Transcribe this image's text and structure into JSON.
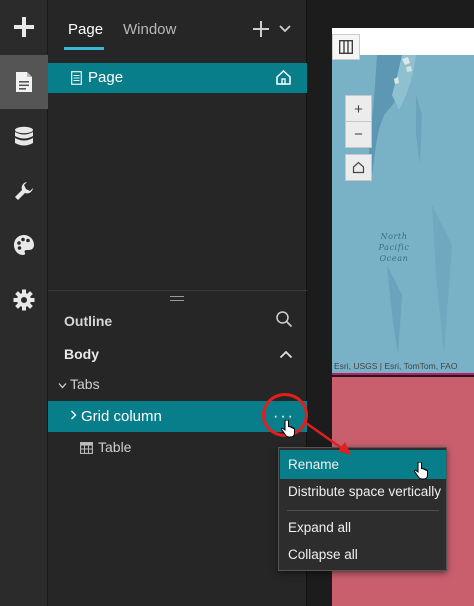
{
  "toolbar": {
    "items": [
      {
        "icon": "plus-icon"
      },
      {
        "icon": "page-icon",
        "active": true
      },
      {
        "icon": "database-icon"
      },
      {
        "icon": "wrench-icon"
      },
      {
        "icon": "palette-icon"
      },
      {
        "icon": "gear-icon"
      }
    ]
  },
  "panel": {
    "tabs": [
      {
        "label": "Page",
        "active": true
      },
      {
        "label": "Window",
        "active": false
      }
    ],
    "page_item": {
      "label": "Page"
    },
    "outline": {
      "title": "Outline",
      "body_label": "Body",
      "tabs_label": "Tabs",
      "grid_column_label": "Grid column",
      "table_label": "Table",
      "more_button": "···"
    }
  },
  "canvas": {
    "attribution": "Esri, USGS | Esri, TomTom, FAO",
    "ocean_label": "North Pacific Ocean",
    "zoom_in": "+",
    "zoom_out": "−"
  },
  "context_menu": {
    "items": [
      {
        "label": "Rename",
        "active": true
      },
      {
        "label": "Distribute space vertically",
        "active": false
      },
      {
        "label": "Expand all",
        "active": false
      },
      {
        "label": "Collapse all",
        "active": false
      }
    ]
  },
  "colors": {
    "accent": "#087e8b",
    "tab_underline": "#3ab7d6",
    "annotation": "#e02020",
    "map_water": "#79b2c7",
    "pink_section": "#c95f6d"
  }
}
